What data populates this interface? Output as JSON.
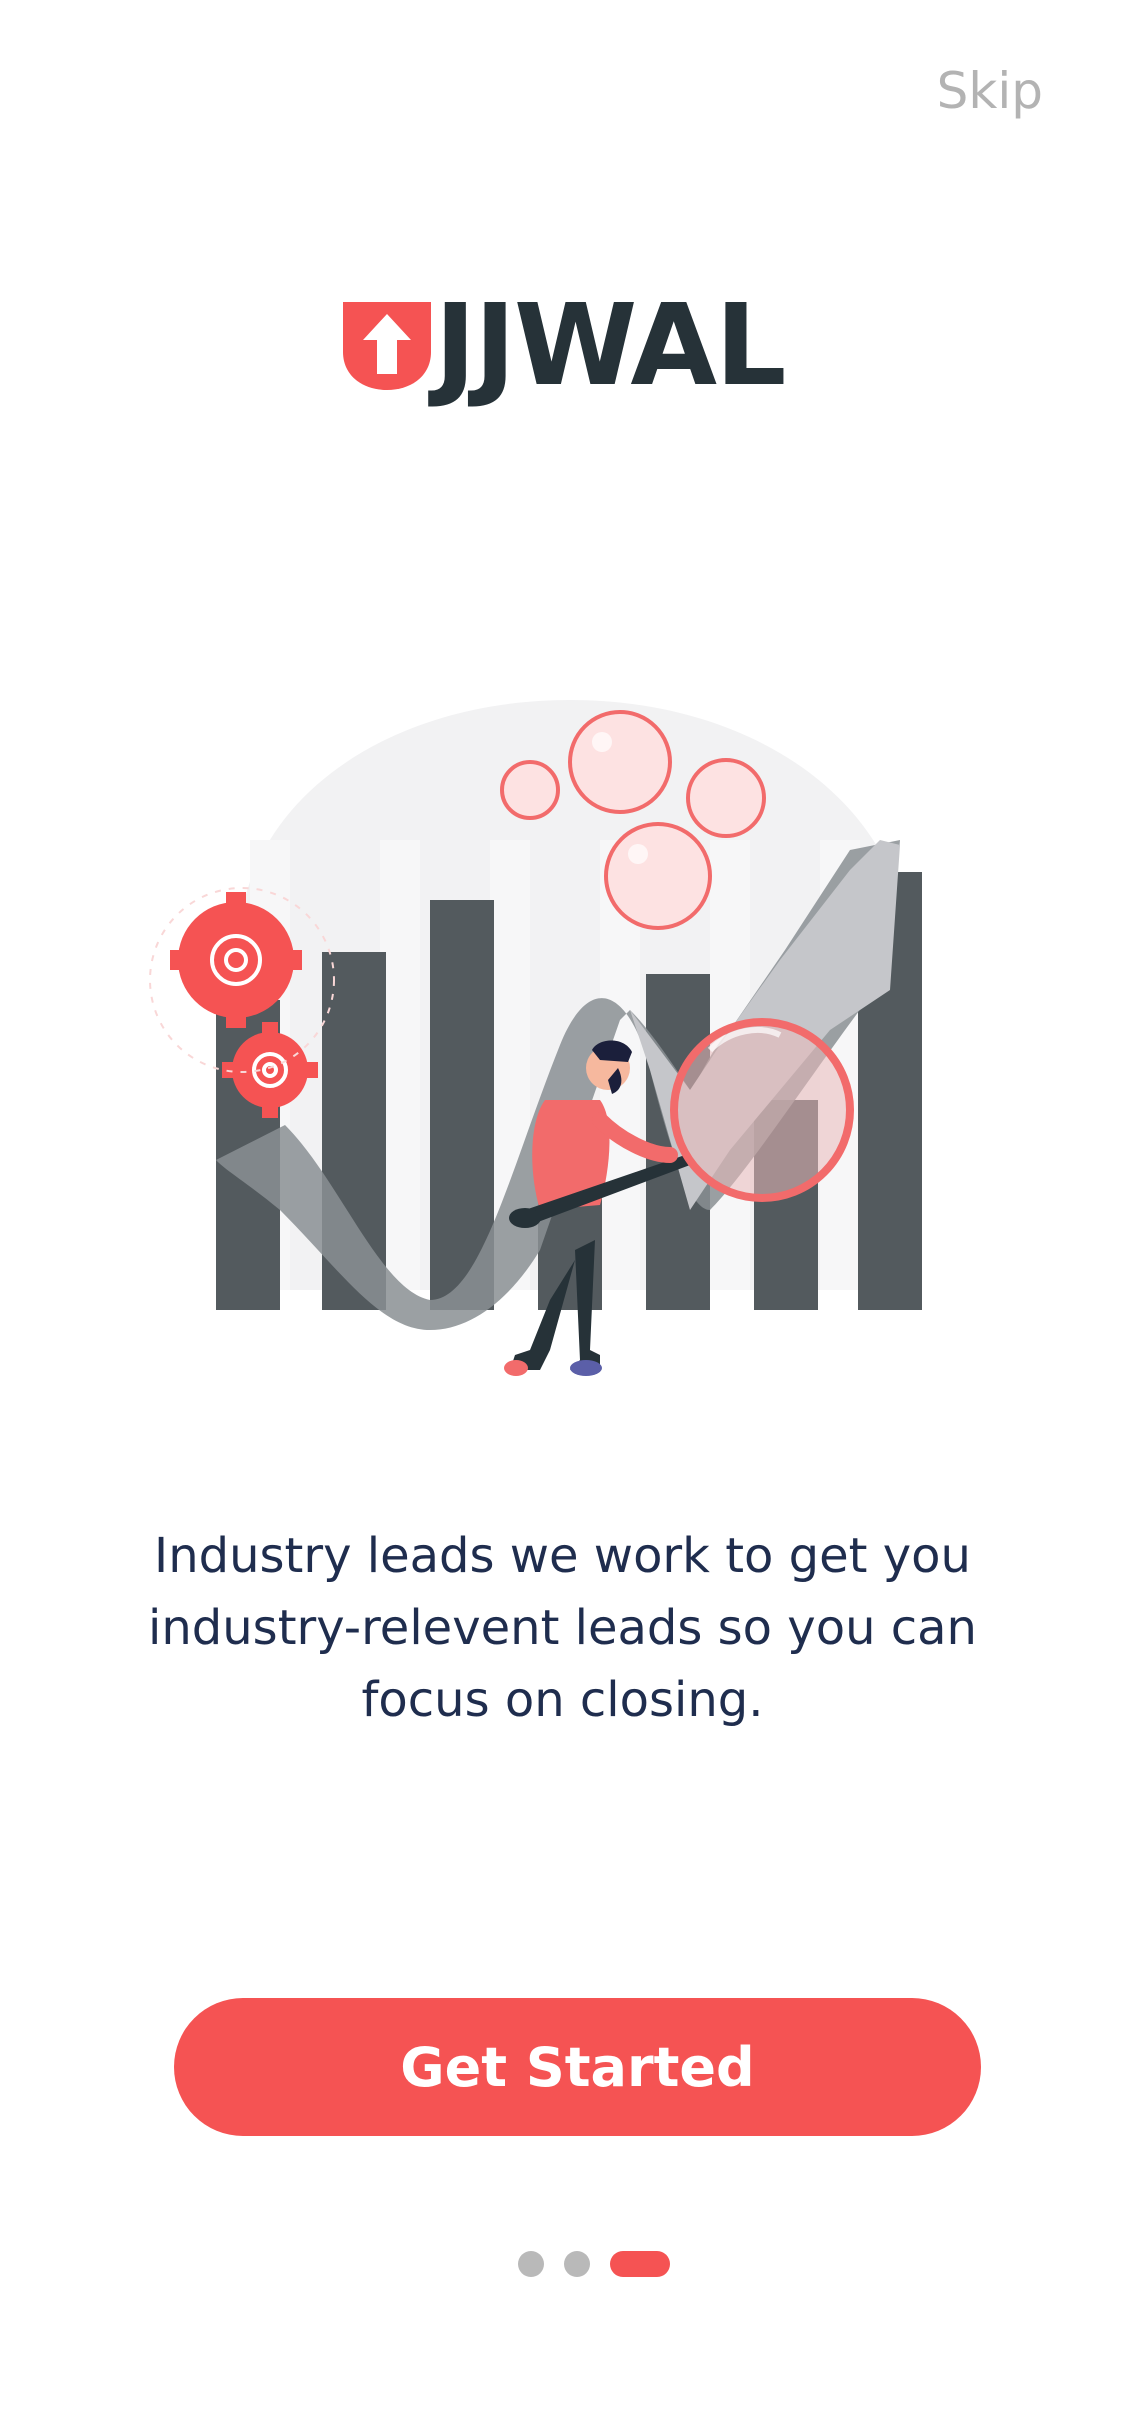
{
  "header": {
    "skip_label": "Skip"
  },
  "logo": {
    "text": "JJWAL",
    "mark_icon": "shield-up-arrow-icon",
    "brand_color": "#f55353",
    "text_color": "#263238"
  },
  "onboarding": {
    "tagline": "Industry leads we work to get you industry-relevent leads so you can focus on closing.",
    "illustration_icon": "analytics-growth-illustration"
  },
  "cta": {
    "label": "Get Started",
    "color": "#f55353"
  },
  "pagination": {
    "total_pages": 3,
    "active_page": 3,
    "active_color": "#f55353",
    "inactive_color": "#b9b9b9"
  }
}
